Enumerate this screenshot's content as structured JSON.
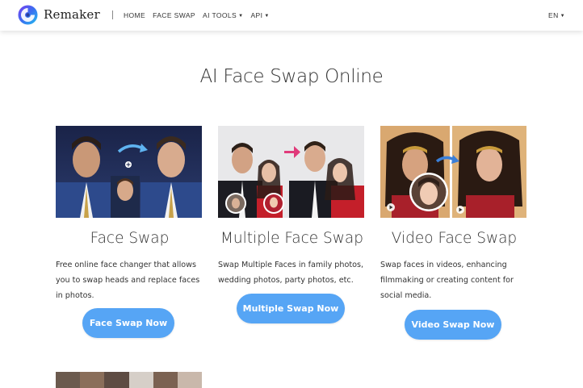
{
  "brand": {
    "name": "Remaker"
  },
  "nav": {
    "items": [
      {
        "label": "HOME",
        "dropdown": false
      },
      {
        "label": "FACE SWAP",
        "dropdown": false
      },
      {
        "label": "AI TOOLS",
        "dropdown": true
      },
      {
        "label": "API",
        "dropdown": true
      }
    ],
    "language": "EN"
  },
  "page": {
    "title": "AI Face Swap Online"
  },
  "cards": [
    {
      "title": "Face Swap",
      "description": "Free online face changer that allows you to swap heads and replace faces in photos.",
      "button": "Face Swap Now"
    },
    {
      "title": "Multiple Face Swap",
      "description": "Swap Multiple Faces in family photos, wedding photos, party photos, etc.",
      "button": "Multiple Swap Now"
    },
    {
      "title": "Video Face Swap",
      "description": "Swap faces in videos, enhancing filmmaking or creating content for social media.",
      "button": "Video Swap Now"
    }
  ],
  "colors": {
    "accent": "#56a5f5",
    "text": "#333333",
    "arrow_blue": "#4a90d9",
    "arrow_pink": "#e03a7a"
  },
  "icons": {
    "logo": "remaker-swirl-logo",
    "play": "play-icon",
    "plus": "plus-icon",
    "arrow": "swap-arrow-icon"
  }
}
